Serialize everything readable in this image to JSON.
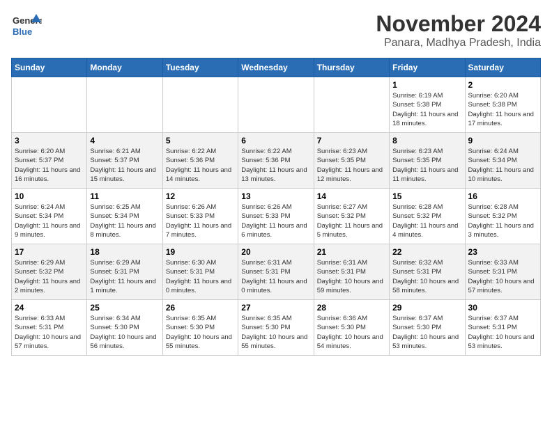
{
  "header": {
    "logo_line1": "General",
    "logo_line2": "Blue",
    "month_title": "November 2024",
    "location": "Panara, Madhya Pradesh, India"
  },
  "weekdays": [
    "Sunday",
    "Monday",
    "Tuesday",
    "Wednesday",
    "Thursday",
    "Friday",
    "Saturday"
  ],
  "weeks": [
    [
      {
        "day": "",
        "info": ""
      },
      {
        "day": "",
        "info": ""
      },
      {
        "day": "",
        "info": ""
      },
      {
        "day": "",
        "info": ""
      },
      {
        "day": "",
        "info": ""
      },
      {
        "day": "1",
        "info": "Sunrise: 6:19 AM\nSunset: 5:38 PM\nDaylight: 11 hours and 18 minutes."
      },
      {
        "day": "2",
        "info": "Sunrise: 6:20 AM\nSunset: 5:38 PM\nDaylight: 11 hours and 17 minutes."
      }
    ],
    [
      {
        "day": "3",
        "info": "Sunrise: 6:20 AM\nSunset: 5:37 PM\nDaylight: 11 hours and 16 minutes."
      },
      {
        "day": "4",
        "info": "Sunrise: 6:21 AM\nSunset: 5:37 PM\nDaylight: 11 hours and 15 minutes."
      },
      {
        "day": "5",
        "info": "Sunrise: 6:22 AM\nSunset: 5:36 PM\nDaylight: 11 hours and 14 minutes."
      },
      {
        "day": "6",
        "info": "Sunrise: 6:22 AM\nSunset: 5:36 PM\nDaylight: 11 hours and 13 minutes."
      },
      {
        "day": "7",
        "info": "Sunrise: 6:23 AM\nSunset: 5:35 PM\nDaylight: 11 hours and 12 minutes."
      },
      {
        "day": "8",
        "info": "Sunrise: 6:23 AM\nSunset: 5:35 PM\nDaylight: 11 hours and 11 minutes."
      },
      {
        "day": "9",
        "info": "Sunrise: 6:24 AM\nSunset: 5:34 PM\nDaylight: 11 hours and 10 minutes."
      }
    ],
    [
      {
        "day": "10",
        "info": "Sunrise: 6:24 AM\nSunset: 5:34 PM\nDaylight: 11 hours and 9 minutes."
      },
      {
        "day": "11",
        "info": "Sunrise: 6:25 AM\nSunset: 5:34 PM\nDaylight: 11 hours and 8 minutes."
      },
      {
        "day": "12",
        "info": "Sunrise: 6:26 AM\nSunset: 5:33 PM\nDaylight: 11 hours and 7 minutes."
      },
      {
        "day": "13",
        "info": "Sunrise: 6:26 AM\nSunset: 5:33 PM\nDaylight: 11 hours and 6 minutes."
      },
      {
        "day": "14",
        "info": "Sunrise: 6:27 AM\nSunset: 5:32 PM\nDaylight: 11 hours and 5 minutes."
      },
      {
        "day": "15",
        "info": "Sunrise: 6:28 AM\nSunset: 5:32 PM\nDaylight: 11 hours and 4 minutes."
      },
      {
        "day": "16",
        "info": "Sunrise: 6:28 AM\nSunset: 5:32 PM\nDaylight: 11 hours and 3 minutes."
      }
    ],
    [
      {
        "day": "17",
        "info": "Sunrise: 6:29 AM\nSunset: 5:32 PM\nDaylight: 11 hours and 2 minutes."
      },
      {
        "day": "18",
        "info": "Sunrise: 6:29 AM\nSunset: 5:31 PM\nDaylight: 11 hours and 1 minute."
      },
      {
        "day": "19",
        "info": "Sunrise: 6:30 AM\nSunset: 5:31 PM\nDaylight: 11 hours and 0 minutes."
      },
      {
        "day": "20",
        "info": "Sunrise: 6:31 AM\nSunset: 5:31 PM\nDaylight: 11 hours and 0 minutes."
      },
      {
        "day": "21",
        "info": "Sunrise: 6:31 AM\nSunset: 5:31 PM\nDaylight: 10 hours and 59 minutes."
      },
      {
        "day": "22",
        "info": "Sunrise: 6:32 AM\nSunset: 5:31 PM\nDaylight: 10 hours and 58 minutes."
      },
      {
        "day": "23",
        "info": "Sunrise: 6:33 AM\nSunset: 5:31 PM\nDaylight: 10 hours and 57 minutes."
      }
    ],
    [
      {
        "day": "24",
        "info": "Sunrise: 6:33 AM\nSunset: 5:31 PM\nDaylight: 10 hours and 57 minutes."
      },
      {
        "day": "25",
        "info": "Sunrise: 6:34 AM\nSunset: 5:30 PM\nDaylight: 10 hours and 56 minutes."
      },
      {
        "day": "26",
        "info": "Sunrise: 6:35 AM\nSunset: 5:30 PM\nDaylight: 10 hours and 55 minutes."
      },
      {
        "day": "27",
        "info": "Sunrise: 6:35 AM\nSunset: 5:30 PM\nDaylight: 10 hours and 55 minutes."
      },
      {
        "day": "28",
        "info": "Sunrise: 6:36 AM\nSunset: 5:30 PM\nDaylight: 10 hours and 54 minutes."
      },
      {
        "day": "29",
        "info": "Sunrise: 6:37 AM\nSunset: 5:30 PM\nDaylight: 10 hours and 53 minutes."
      },
      {
        "day": "30",
        "info": "Sunrise: 6:37 AM\nSunset: 5:31 PM\nDaylight: 10 hours and 53 minutes."
      }
    ]
  ]
}
